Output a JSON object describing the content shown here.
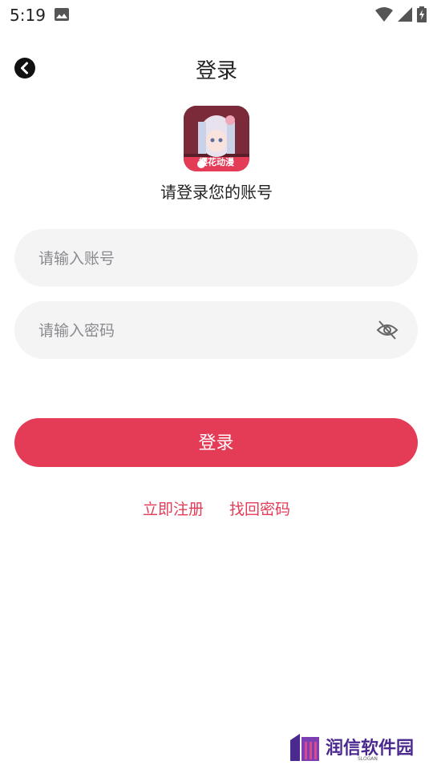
{
  "status_bar": {
    "time": "5:19",
    "icons": [
      "image-icon",
      "wifi-icon",
      "signal-icon",
      "battery-charging-icon"
    ]
  },
  "header": {
    "title": "登录",
    "back_icon": "back-icon"
  },
  "app": {
    "logo_text": "樱花动漫",
    "subtitle": "请登录您的账号"
  },
  "form": {
    "account": {
      "value": "",
      "placeholder": "请输入账号"
    },
    "password": {
      "value": "",
      "placeholder": "请输入密码",
      "toggle_icon": "eye-off-icon"
    },
    "submit_label": "登录"
  },
  "links": {
    "register": "立即注册",
    "forgot_password": "找回密码"
  },
  "watermark": {
    "text": "润信软件园",
    "slogan": "SLOGAN"
  },
  "colors": {
    "accent": "#e43b57",
    "field_bg": "#f4f4f5",
    "watermark": "#4b2a8f"
  }
}
